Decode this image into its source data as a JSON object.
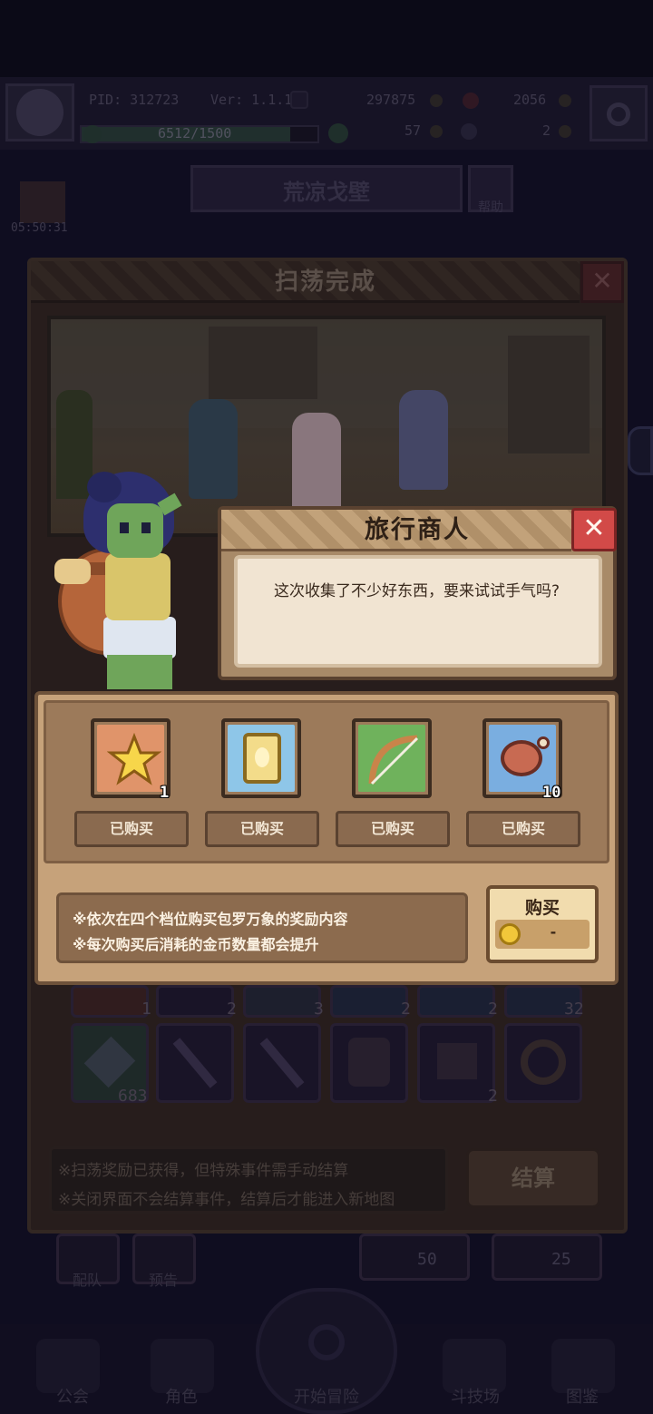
{
  "hud": {
    "pid_label": "PID: 312723",
    "version_label": "Ver: 1.1.1.3",
    "gold": "297875",
    "gems": "2056",
    "xp": "6512/1500",
    "clover": "57",
    "keys": "2"
  },
  "map": {
    "title": "荒凉戈壁",
    "help_label": "帮助",
    "gift_timer": "05:50:31"
  },
  "sweep_panel": {
    "title": "扫荡完成",
    "close_glyph": "✕",
    "grid_counts_row1": [
      "1",
      "2",
      "3",
      "2",
      "2",
      "32"
    ],
    "grid_counts_row2": [
      "683",
      "",
      "",
      "",
      "2",
      ""
    ],
    "footer_lines": [
      "※扫荡奖励已获得，但特殊事件需手动结算",
      "※关闭界面不会结算事件，结算后才能进入新地图"
    ],
    "settle_label": "结算"
  },
  "merchant_dialog": {
    "title": "旅行商人",
    "close_glyph": "✕",
    "text": "这次收集了不少好东西，要来试试手气吗?"
  },
  "shop": {
    "items": [
      {
        "icon": "star-icon",
        "qty": "1",
        "status": "已购买",
        "bg": "#e0946a"
      },
      {
        "icon": "golden-card-icon",
        "qty": "",
        "status": "已购买",
        "bg": "#8ec6e8"
      },
      {
        "icon": "bow-icon",
        "qty": "",
        "status": "已购买",
        "bg": "#6fb25c"
      },
      {
        "icon": "meat-icon",
        "qty": "10",
        "status": "已购买",
        "bg": "#7aaee0"
      }
    ],
    "info_lines": [
      "※依次在四个档位购买包罗万象的奖励内容",
      "※每次购买后消耗的金币数量都会提升"
    ],
    "buy_label": "购买",
    "price": "-"
  },
  "bottom_nav": {
    "items": [
      "公会",
      "角色",
      "开始冒险",
      "斗技场",
      "图鉴"
    ],
    "team_label": "配队",
    "preview_label": "预告",
    "cost_a": "50",
    "cost_b": "25"
  }
}
